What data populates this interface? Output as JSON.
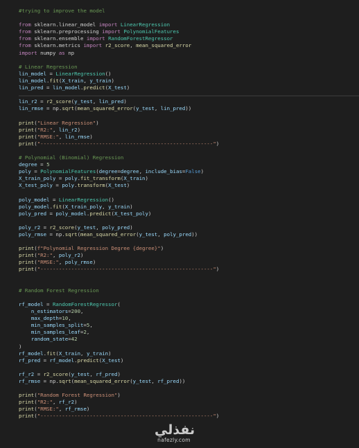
{
  "code_lines": [
    [
      {
        "t": "comment",
        "v": "#trying to improve the model"
      }
    ],
    [],
    [
      {
        "t": "keyword",
        "v": "from"
      },
      {
        "t": "plain",
        "v": " sklearn.linear_model "
      },
      {
        "t": "keyword",
        "v": "import"
      },
      {
        "t": "plain",
        "v": " "
      },
      {
        "t": "class",
        "v": "LinearRegression"
      }
    ],
    [
      {
        "t": "keyword",
        "v": "from"
      },
      {
        "t": "plain",
        "v": " sklearn.preprocessing "
      },
      {
        "t": "keyword",
        "v": "import"
      },
      {
        "t": "plain",
        "v": " "
      },
      {
        "t": "class",
        "v": "PolynomialFeatures"
      }
    ],
    [
      {
        "t": "keyword",
        "v": "from"
      },
      {
        "t": "plain",
        "v": " sklearn.ensemble "
      },
      {
        "t": "keyword",
        "v": "import"
      },
      {
        "t": "plain",
        "v": " "
      },
      {
        "t": "class",
        "v": "RandomForestRegressor"
      }
    ],
    [
      {
        "t": "keyword",
        "v": "from"
      },
      {
        "t": "plain",
        "v": " sklearn.metrics "
      },
      {
        "t": "keyword",
        "v": "import"
      },
      {
        "t": "plain",
        "v": " "
      },
      {
        "t": "function",
        "v": "r2_score"
      },
      {
        "t": "plain",
        "v": ", "
      },
      {
        "t": "function",
        "v": "mean_squared_error"
      }
    ],
    [
      {
        "t": "keyword",
        "v": "import"
      },
      {
        "t": "plain",
        "v": " numpy "
      },
      {
        "t": "keyword",
        "v": "as"
      },
      {
        "t": "plain",
        "v": " np"
      }
    ],
    [],
    [
      {
        "t": "comment",
        "v": "# Linear Regression"
      }
    ],
    [
      {
        "t": "variable",
        "v": "lin_model"
      },
      {
        "t": "plain",
        "v": " = "
      },
      {
        "t": "class",
        "v": "LinearRegression"
      },
      {
        "t": "plain",
        "v": "()"
      }
    ],
    [
      {
        "t": "variable",
        "v": "lin_model"
      },
      {
        "t": "plain",
        "v": "."
      },
      {
        "t": "function",
        "v": "fit"
      },
      {
        "t": "plain",
        "v": "("
      },
      {
        "t": "variable",
        "v": "X_train"
      },
      {
        "t": "plain",
        "v": ", "
      },
      {
        "t": "variable",
        "v": "y_train"
      },
      {
        "t": "plain",
        "v": ")"
      }
    ],
    [
      {
        "t": "variable",
        "v": "lin_pred"
      },
      {
        "t": "plain",
        "v": " = "
      },
      {
        "t": "variable",
        "v": "lin_model"
      },
      {
        "t": "plain",
        "v": "."
      },
      {
        "t": "function",
        "v": "predict"
      },
      {
        "t": "plain",
        "v": "("
      },
      {
        "t": "variable",
        "v": "X_test"
      },
      {
        "t": "plain",
        "v": ")"
      }
    ],
    [],
    [
      {
        "t": "variable",
        "v": "lin_r2"
      },
      {
        "t": "plain",
        "v": " = "
      },
      {
        "t": "function",
        "v": "r2_score"
      },
      {
        "t": "plain",
        "v": "("
      },
      {
        "t": "variable",
        "v": "y_test"
      },
      {
        "t": "plain",
        "v": ", "
      },
      {
        "t": "variable",
        "v": "lin_pred"
      },
      {
        "t": "plain",
        "v": ")"
      }
    ],
    [
      {
        "t": "variable",
        "v": "lin_rmse"
      },
      {
        "t": "plain",
        "v": " = np."
      },
      {
        "t": "function",
        "v": "sqrt"
      },
      {
        "t": "plain",
        "v": "("
      },
      {
        "t": "function",
        "v": "mean_squared_error"
      },
      {
        "t": "plain",
        "v": "("
      },
      {
        "t": "variable",
        "v": "y_test"
      },
      {
        "t": "plain",
        "v": ", "
      },
      {
        "t": "variable",
        "v": "lin_pred"
      },
      {
        "t": "plain",
        "v": "))"
      }
    ],
    [],
    [
      {
        "t": "function",
        "v": "print"
      },
      {
        "t": "plain",
        "v": "("
      },
      {
        "t": "string",
        "v": "\"Linear Regression\""
      },
      {
        "t": "plain",
        "v": ")"
      }
    ],
    [
      {
        "t": "function",
        "v": "print"
      },
      {
        "t": "plain",
        "v": "("
      },
      {
        "t": "string",
        "v": "\"R2:\""
      },
      {
        "t": "plain",
        "v": ", "
      },
      {
        "t": "variable",
        "v": "lin_r2"
      },
      {
        "t": "plain",
        "v": ")"
      }
    ],
    [
      {
        "t": "function",
        "v": "print"
      },
      {
        "t": "plain",
        "v": "("
      },
      {
        "t": "string",
        "v": "\"RMSE:\""
      },
      {
        "t": "plain",
        "v": ", "
      },
      {
        "t": "variable",
        "v": "lin_rmse"
      },
      {
        "t": "plain",
        "v": ")"
      }
    ],
    [
      {
        "t": "function",
        "v": "print"
      },
      {
        "t": "plain",
        "v": "("
      },
      {
        "t": "string",
        "v": "\"--------------------------------------------------------\""
      },
      {
        "t": "plain",
        "v": ")"
      }
    ],
    [],
    [
      {
        "t": "comment",
        "v": "# Polynomial (Binomial) Regression"
      }
    ],
    [
      {
        "t": "variable",
        "v": "degree"
      },
      {
        "t": "plain",
        "v": " = "
      },
      {
        "t": "number",
        "v": "5"
      }
    ],
    [
      {
        "t": "variable",
        "v": "poly"
      },
      {
        "t": "plain",
        "v": " = "
      },
      {
        "t": "class",
        "v": "PolynomialFeatures"
      },
      {
        "t": "plain",
        "v": "("
      },
      {
        "t": "variable",
        "v": "degree"
      },
      {
        "t": "plain",
        "v": "="
      },
      {
        "t": "variable",
        "v": "degree"
      },
      {
        "t": "plain",
        "v": ", "
      },
      {
        "t": "variable",
        "v": "include_bias"
      },
      {
        "t": "plain",
        "v": "="
      },
      {
        "t": "constant",
        "v": "False"
      },
      {
        "t": "plain",
        "v": ")"
      }
    ],
    [
      {
        "t": "variable",
        "v": "X_train_poly"
      },
      {
        "t": "plain",
        "v": " = "
      },
      {
        "t": "variable",
        "v": "poly"
      },
      {
        "t": "plain",
        "v": "."
      },
      {
        "t": "function",
        "v": "fit_transform"
      },
      {
        "t": "plain",
        "v": "("
      },
      {
        "t": "variable",
        "v": "X_train"
      },
      {
        "t": "plain",
        "v": ")"
      }
    ],
    [
      {
        "t": "variable",
        "v": "X_test_poly"
      },
      {
        "t": "plain",
        "v": " = "
      },
      {
        "t": "variable",
        "v": "poly"
      },
      {
        "t": "plain",
        "v": "."
      },
      {
        "t": "function",
        "v": "transform"
      },
      {
        "t": "plain",
        "v": "("
      },
      {
        "t": "variable",
        "v": "X_test"
      },
      {
        "t": "plain",
        "v": ")"
      }
    ],
    [],
    [
      {
        "t": "variable",
        "v": "poly_model"
      },
      {
        "t": "plain",
        "v": " = "
      },
      {
        "t": "class",
        "v": "LinearRegression"
      },
      {
        "t": "plain",
        "v": "()"
      }
    ],
    [
      {
        "t": "variable",
        "v": "poly_model"
      },
      {
        "t": "plain",
        "v": "."
      },
      {
        "t": "function",
        "v": "fit"
      },
      {
        "t": "plain",
        "v": "("
      },
      {
        "t": "variable",
        "v": "X_train_poly"
      },
      {
        "t": "plain",
        "v": ", "
      },
      {
        "t": "variable",
        "v": "y_train"
      },
      {
        "t": "plain",
        "v": ")"
      }
    ],
    [
      {
        "t": "variable",
        "v": "poly_pred"
      },
      {
        "t": "plain",
        "v": " = "
      },
      {
        "t": "variable",
        "v": "poly_model"
      },
      {
        "t": "plain",
        "v": "."
      },
      {
        "t": "function",
        "v": "predict"
      },
      {
        "t": "plain",
        "v": "("
      },
      {
        "t": "variable",
        "v": "X_test_poly"
      },
      {
        "t": "plain",
        "v": ")"
      }
    ],
    [],
    [
      {
        "t": "variable",
        "v": "poly_r2"
      },
      {
        "t": "plain",
        "v": " = "
      },
      {
        "t": "function",
        "v": "r2_score"
      },
      {
        "t": "plain",
        "v": "("
      },
      {
        "t": "variable",
        "v": "y_test"
      },
      {
        "t": "plain",
        "v": ", "
      },
      {
        "t": "variable",
        "v": "poly_pred"
      },
      {
        "t": "plain",
        "v": ")"
      }
    ],
    [
      {
        "t": "variable",
        "v": "poly_rmse"
      },
      {
        "t": "plain",
        "v": " = np."
      },
      {
        "t": "function",
        "v": "sqrt"
      },
      {
        "t": "plain",
        "v": "("
      },
      {
        "t": "function",
        "v": "mean_squared_error"
      },
      {
        "t": "plain",
        "v": "("
      },
      {
        "t": "variable",
        "v": "y_test"
      },
      {
        "t": "plain",
        "v": ", "
      },
      {
        "t": "variable",
        "v": "poly_pred"
      },
      {
        "t": "plain",
        "v": "))"
      }
    ],
    [],
    [
      {
        "t": "function",
        "v": "print"
      },
      {
        "t": "plain",
        "v": "("
      },
      {
        "t": "string",
        "v": "f\"Polynomial Regression Degree {degree}\""
      },
      {
        "t": "plain",
        "v": ")"
      }
    ],
    [
      {
        "t": "function",
        "v": "print"
      },
      {
        "t": "plain",
        "v": "("
      },
      {
        "t": "string",
        "v": "\"R2:\""
      },
      {
        "t": "plain",
        "v": ", "
      },
      {
        "t": "variable",
        "v": "poly_r2"
      },
      {
        "t": "plain",
        "v": ")"
      }
    ],
    [
      {
        "t": "function",
        "v": "print"
      },
      {
        "t": "plain",
        "v": "("
      },
      {
        "t": "string",
        "v": "\"RMSE:\""
      },
      {
        "t": "plain",
        "v": ", "
      },
      {
        "t": "variable",
        "v": "poly_rmse"
      },
      {
        "t": "plain",
        "v": ")"
      }
    ],
    [
      {
        "t": "function",
        "v": "print"
      },
      {
        "t": "plain",
        "v": "("
      },
      {
        "t": "string",
        "v": "\"--------------------------------------------------------\""
      },
      {
        "t": "plain",
        "v": ")"
      }
    ],
    [],
    [],
    [
      {
        "t": "comment",
        "v": "# Random Forest Regression"
      }
    ],
    [],
    [
      {
        "t": "variable",
        "v": "rf_model"
      },
      {
        "t": "plain",
        "v": " = "
      },
      {
        "t": "class",
        "v": "RandomForestRegressor"
      },
      {
        "t": "plain",
        "v": "("
      }
    ],
    [
      {
        "t": "plain",
        "v": "    "
      },
      {
        "t": "variable",
        "v": "n_estimators"
      },
      {
        "t": "plain",
        "v": "="
      },
      {
        "t": "number",
        "v": "200"
      },
      {
        "t": "plain",
        "v": ","
      }
    ],
    [
      {
        "t": "plain",
        "v": "    "
      },
      {
        "t": "variable",
        "v": "max_depth"
      },
      {
        "t": "plain",
        "v": "="
      },
      {
        "t": "number",
        "v": "10"
      },
      {
        "t": "plain",
        "v": ","
      }
    ],
    [
      {
        "t": "plain",
        "v": "    "
      },
      {
        "t": "variable",
        "v": "min_samples_split"
      },
      {
        "t": "plain",
        "v": "="
      },
      {
        "t": "number",
        "v": "5"
      },
      {
        "t": "plain",
        "v": ","
      }
    ],
    [
      {
        "t": "plain",
        "v": "    "
      },
      {
        "t": "variable",
        "v": "min_samples_leaf"
      },
      {
        "t": "plain",
        "v": "="
      },
      {
        "t": "number",
        "v": "2"
      },
      {
        "t": "plain",
        "v": ","
      }
    ],
    [
      {
        "t": "plain",
        "v": "    "
      },
      {
        "t": "variable",
        "v": "random_state"
      },
      {
        "t": "plain",
        "v": "="
      },
      {
        "t": "number",
        "v": "42"
      }
    ],
    [
      {
        "t": "plain",
        "v": ")"
      }
    ],
    [
      {
        "t": "variable",
        "v": "rf_model"
      },
      {
        "t": "plain",
        "v": "."
      },
      {
        "t": "function",
        "v": "fit"
      },
      {
        "t": "plain",
        "v": "("
      },
      {
        "t": "variable",
        "v": "X_train"
      },
      {
        "t": "plain",
        "v": ", "
      },
      {
        "t": "variable",
        "v": "y_train"
      },
      {
        "t": "plain",
        "v": ")"
      }
    ],
    [
      {
        "t": "variable",
        "v": "rf_pred"
      },
      {
        "t": "plain",
        "v": " = "
      },
      {
        "t": "variable",
        "v": "rf_model"
      },
      {
        "t": "plain",
        "v": "."
      },
      {
        "t": "function",
        "v": "predict"
      },
      {
        "t": "plain",
        "v": "("
      },
      {
        "t": "variable",
        "v": "X_test"
      },
      {
        "t": "plain",
        "v": ")"
      }
    ],
    [],
    [
      {
        "t": "variable",
        "v": "rf_r2"
      },
      {
        "t": "plain",
        "v": " = "
      },
      {
        "t": "function",
        "v": "r2_score"
      },
      {
        "t": "plain",
        "v": "("
      },
      {
        "t": "variable",
        "v": "y_test"
      },
      {
        "t": "plain",
        "v": ", "
      },
      {
        "t": "variable",
        "v": "rf_pred"
      },
      {
        "t": "plain",
        "v": ")"
      }
    ],
    [
      {
        "t": "variable",
        "v": "rf_rmse"
      },
      {
        "t": "plain",
        "v": " = np."
      },
      {
        "t": "function",
        "v": "sqrt"
      },
      {
        "t": "plain",
        "v": "("
      },
      {
        "t": "function",
        "v": "mean_squared_error"
      },
      {
        "t": "plain",
        "v": "("
      },
      {
        "t": "variable",
        "v": "y_test"
      },
      {
        "t": "plain",
        "v": ", "
      },
      {
        "t": "variable",
        "v": "rf_pred"
      },
      {
        "t": "plain",
        "v": "))"
      }
    ],
    [],
    [
      {
        "t": "function",
        "v": "print"
      },
      {
        "t": "plain",
        "v": "("
      },
      {
        "t": "string",
        "v": "\"Random Forest Regression\""
      },
      {
        "t": "plain",
        "v": ")"
      }
    ],
    [
      {
        "t": "function",
        "v": "print"
      },
      {
        "t": "plain",
        "v": "("
      },
      {
        "t": "string",
        "v": "\"R2:\""
      },
      {
        "t": "plain",
        "v": ", "
      },
      {
        "t": "variable",
        "v": "rf_r2"
      },
      {
        "t": "plain",
        "v": ")"
      }
    ],
    [
      {
        "t": "function",
        "v": "print"
      },
      {
        "t": "plain",
        "v": "("
      },
      {
        "t": "string",
        "v": "\"RMSE:\""
      },
      {
        "t": "plain",
        "v": ", "
      },
      {
        "t": "variable",
        "v": "rf_rmse"
      },
      {
        "t": "plain",
        "v": ")"
      }
    ],
    [
      {
        "t": "function",
        "v": "print"
      },
      {
        "t": "plain",
        "v": "("
      },
      {
        "t": "string",
        "v": "\"--------------------------------------------------------\""
      },
      {
        "t": "plain",
        "v": ")"
      }
    ]
  ],
  "watermark": {
    "logo_text": "نفذلي",
    "domain_text": "nafezly.com"
  },
  "theme": {
    "background": "#1e1e1e",
    "comment": "#6a9955",
    "keyword": "#c586c0",
    "function": "#dcdcaa",
    "class": "#4ec9b0",
    "variable": "#9cdcfe",
    "string": "#ce9178",
    "number": "#b5cea8",
    "constant": "#569cd6"
  }
}
